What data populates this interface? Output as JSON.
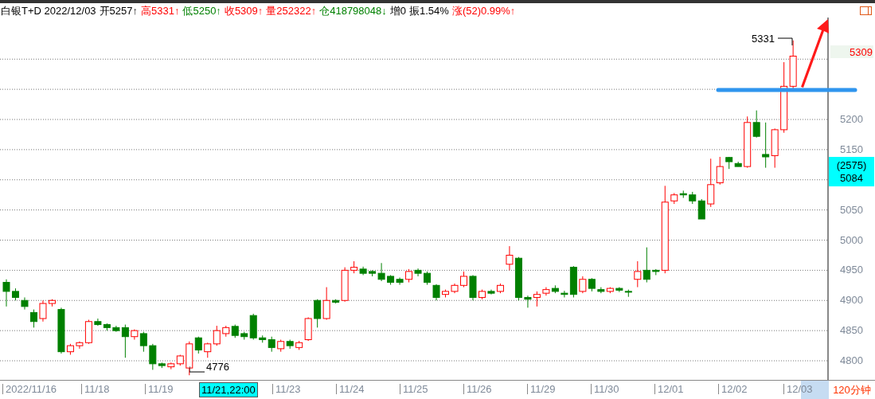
{
  "header": [
    {
      "text": "白银T+D 2022/12/03"
    },
    {
      "text": "开5257↑"
    },
    {
      "text": "高5331↑",
      "color": "#ff0000"
    },
    {
      "text": "低5250↑",
      "color": "#008000"
    },
    {
      "text": "收5309↑",
      "color": "#ff0000"
    },
    {
      "text": "量252322↑",
      "color": "#ff0000"
    },
    {
      "text": "仓418798048↓",
      "color": "#008000"
    },
    {
      "text": "增0"
    },
    {
      "text": "振1.54%"
    },
    {
      "text": "涨(52)0.99%↑",
      "color": "#ff0000"
    }
  ],
  "chart": {
    "high_label": "5331",
    "low_label": "4776",
    "chart_data": {
      "type": "candlestick",
      "ylim": [
        4767,
        5369
      ],
      "grid": true,
      "yticks": [
        {
          "value": 5200,
          "label": "5200"
        },
        {
          "value": 5150,
          "label": "5150"
        },
        {
          "value": 5050,
          "label": "5050"
        },
        {
          "value": 5000,
          "label": "5000"
        },
        {
          "value": 4950,
          "label": "4950"
        },
        {
          "value": 4900,
          "label": "4900"
        },
        {
          "value": 4850,
          "label": "4850"
        },
        {
          "value": 4800,
          "label": "4800"
        }
      ],
      "ohlc": [
        [
          4930,
          4935,
          4890,
          4915
        ],
        [
          4915,
          4920,
          4900,
          4905
        ],
        [
          4900,
          4905,
          4885,
          4890
        ],
        [
          4880,
          4885,
          4855,
          4865
        ],
        [
          4870,
          4900,
          4865,
          4895
        ],
        [
          4895,
          4902,
          4890,
          4900
        ],
        [
          4885,
          4888,
          4812,
          4815
        ],
        [
          4815,
          4828,
          4810,
          4825
        ],
        [
          4825,
          4832,
          4820,
          4830
        ],
        [
          4830,
          4868,
          4828,
          4865
        ],
        [
          4865,
          4870,
          4858,
          4860
        ],
        [
          4860,
          4862,
          4850,
          4855
        ],
        [
          4855,
          4858,
          4848,
          4850
        ],
        [
          4855,
          4860,
          4805,
          4840
        ],
        [
          4840,
          4852,
          4835,
          4850
        ],
        [
          4845,
          4848,
          4815,
          4825
        ],
        [
          4825,
          4828,
          4785,
          4795
        ],
        [
          4795,
          4797,
          4788,
          4792
        ],
        [
          4790,
          4797,
          4786,
          4795
        ],
        [
          4795,
          4810,
          4792,
          4808
        ],
        [
          4788,
          4832,
          4776,
          4828
        ],
        [
          4838,
          4840,
          4812,
          4818
        ],
        [
          4815,
          4830,
          4805,
          4828
        ],
        [
          4828,
          4858,
          4825,
          4850
        ],
        [
          4845,
          4858,
          4840,
          4855
        ],
        [
          4857,
          4860,
          4838,
          4842
        ],
        [
          4845,
          4848,
          4835,
          4840
        ],
        [
          4875,
          4878,
          4835,
          4838
        ],
        [
          4838,
          4842,
          4830,
          4835
        ],
        [
          4835,
          4840,
          4815,
          4822
        ],
        [
          4820,
          4835,
          4815,
          4832
        ],
        [
          4832,
          4835,
          4820,
          4825
        ],
        [
          4822,
          4833,
          4818,
          4830
        ],
        [
          4835,
          4872,
          4833,
          4870
        ],
        [
          4900,
          4902,
          4855,
          4870
        ],
        [
          4870,
          4922,
          4868,
          4900
        ],
        [
          4900,
          4902,
          4895,
          4897
        ],
        [
          4900,
          4955,
          4898,
          4950
        ],
        [
          4950,
          4965,
          4945,
          4955
        ],
        [
          4952,
          4956,
          4942,
          4945
        ],
        [
          4948,
          4950,
          4940,
          4945
        ],
        [
          4945,
          4962,
          4932,
          4935
        ],
        [
          4940,
          4942,
          4926,
          4930
        ],
        [
          4935,
          4938,
          4926,
          4930
        ],
        [
          4935,
          4952,
          4930,
          4948
        ],
        [
          4950,
          4953,
          4940,
          4945
        ],
        [
          4945,
          4948,
          4926,
          4930
        ],
        [
          4925,
          4927,
          4900,
          4905
        ],
        [
          4910,
          4918,
          4905,
          4915
        ],
        [
          4915,
          4928,
          4912,
          4925
        ],
        [
          4925,
          4948,
          4922,
          4940
        ],
        [
          4940,
          4942,
          4900,
          4905
        ],
        [
          4905,
          4918,
          4902,
          4915
        ],
        [
          4915,
          4918,
          4910,
          4912
        ],
        [
          4915,
          4928,
          4912,
          4925
        ],
        [
          4960,
          4990,
          4950,
          4975
        ],
        [
          4970,
          4972,
          4900,
          4905
        ],
        [
          4905,
          4908,
          4888,
          4902
        ],
        [
          4905,
          4915,
          4890,
          4910
        ],
        [
          4912,
          4922,
          4908,
          4918
        ],
        [
          4920,
          4925,
          4912,
          4915
        ],
        [
          4912,
          4916,
          4905,
          4910
        ],
        [
          4955,
          4957,
          4905,
          4910
        ],
        [
          4915,
          4940,
          4912,
          4935
        ],
        [
          4935,
          4937,
          4915,
          4920
        ],
        [
          4918,
          4922,
          4912,
          4915
        ],
        [
          4915,
          4922,
          4912,
          4920
        ],
        [
          4920,
          4922,
          4914,
          4917
        ],
        [
          4915,
          4918,
          4906,
          4914
        ],
        [
          4935,
          4965,
          4922,
          4948
        ],
        [
          4950,
          4988,
          4930,
          4935
        ],
        [
          4950,
          4952,
          4942,
          4948
        ],
        [
          4950,
          5090,
          4945,
          5063
        ],
        [
          5065,
          5078,
          5060,
          5075
        ],
        [
          5077,
          5082,
          5070,
          5075
        ],
        [
          5075,
          5080,
          5060,
          5065
        ],
        [
          5065,
          5068,
          5035,
          5035
        ],
        [
          5060,
          5135,
          5055,
          5092
        ],
        [
          5095,
          5138,
          5092,
          5122
        ],
        [
          5137,
          5138,
          5118,
          5130
        ],
        [
          5127,
          5130,
          5122,
          5122
        ],
        [
          5122,
          5205,
          5120,
          5195
        ],
        [
          5195,
          5215,
          5170,
          5172
        ],
        [
          5142,
          5195,
          5120,
          5138
        ],
        [
          5140,
          5185,
          5120,
          5183
        ],
        [
          5183,
          5295,
          5178,
          5255
        ],
        [
          5255,
          5331,
          5250,
          5305
        ]
      ]
    }
  },
  "price_axis": {
    "last_price": "5309",
    "cursor_box": [
      "(2575)",
      "5084"
    ]
  },
  "date_axis": [
    {
      "label": "2022/11/16",
      "kind": "date"
    },
    {
      "label": "11/18",
      "kind": "date"
    },
    {
      "label": "11/19",
      "kind": "date"
    },
    {
      "label": "11/21,22:00",
      "kind": "cursor"
    },
    {
      "label": "11/23",
      "kind": "date"
    },
    {
      "label": "11/24",
      "kind": "date"
    },
    {
      "label": "11/25",
      "kind": "date"
    },
    {
      "label": "11/26",
      "kind": "date"
    },
    {
      "label": "11/29",
      "kind": "date"
    },
    {
      "label": "11/30",
      "kind": "date"
    },
    {
      "label": "12/01",
      "kind": "date"
    },
    {
      "label": "12/02",
      "kind": "date"
    },
    {
      "label": "12/03",
      "kind": "date"
    }
  ],
  "period": "120分钟"
}
